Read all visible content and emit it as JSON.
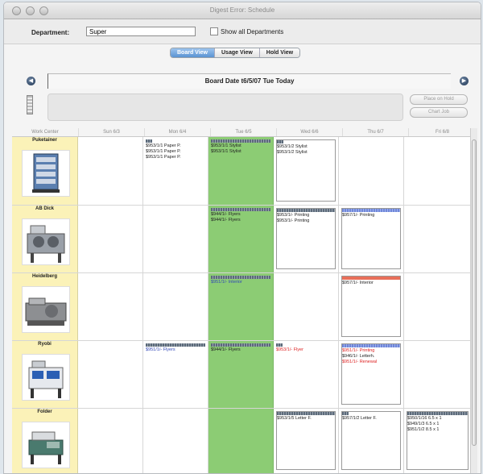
{
  "window": {
    "title": "Digest Error: Schedule"
  },
  "toolbar": {
    "department_label": "Department:",
    "department_value": "Super",
    "show_all_label": "Show all Departments"
  },
  "views": [
    "Board View",
    "Usage View",
    "Hold View"
  ],
  "active_view": "Board View",
  "board": {
    "date_text": "Board Date t6/5/07 Tue Today",
    "place_on_hold": "Place on Hold",
    "chart_job": "Chart Job"
  },
  "grid": {
    "headers": [
      "Work Center",
      "Sun 6/3",
      "Mon 6/4",
      "Tue 6/5",
      "Wed 6/6",
      "Thu 6/7",
      "Fri 6/8"
    ],
    "rows": [
      {
        "name": "Puketainer",
        "days": [
          [],
          [
            "$953/1/1 Paper P.",
            "$953/1/1 Paper P.",
            "$953/1/1 Paper P."
          ],
          [
            "$953/1/1 Stylist",
            "$953/1/1 Stylist"
          ],
          [
            "$953/1/2 Stylist",
            "$953/1/2 Stylist"
          ],
          [],
          []
        ]
      },
      {
        "name": "AB Dick",
        "days": [
          [],
          [],
          [
            "$944/1/- Flyers",
            "$944/1/- Flyers"
          ],
          [
            "$953/1/- Printing",
            "$953/1/- Printing"
          ],
          [
            "$957/1/- Printing"
          ],
          []
        ]
      },
      {
        "name": "Heidelberg",
        "days": [
          [],
          [],
          [
            "$951/1/- Interior"
          ],
          [],
          [
            "$957/1/- Interior"
          ],
          []
        ]
      },
      {
        "name": "Ryobi",
        "days": [
          [],
          [
            "$951/1/- Flyers"
          ],
          [
            "$944/1/- Flyers"
          ],
          [
            "$953/1/- Flyer"
          ],
          [
            "$951/1/- Printing",
            "$946/1/- Letterh.",
            "$951/1/- Renewal"
          ],
          []
        ]
      },
      {
        "name": "Folder",
        "days": [
          [],
          [],
          [],
          [
            "$953/1/5 Letter F."
          ],
          [
            "$957/1/2 Letter F."
          ],
          [
            "$950/1/16 6.5 x 1",
            "$949/1/3 6.5 x 1",
            "$951/1/2 8.5 x 1"
          ]
        ]
      }
    ]
  }
}
